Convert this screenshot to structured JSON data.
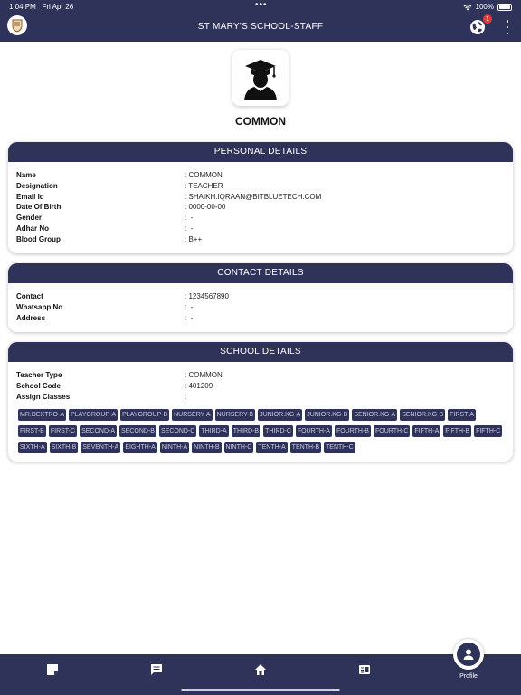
{
  "status": {
    "time": "1:04 PM",
    "date": "Fri Apr 26",
    "battery": "100%"
  },
  "header": {
    "title": "ST MARY'S SCHOOL-STAFF",
    "notification_count": "1"
  },
  "profile": {
    "name": "COMMON"
  },
  "personal": {
    "title": "PERSONAL DETAILS",
    "rows": [
      {
        "label": "Name",
        "value": ": COMMON"
      },
      {
        "label": "Designation",
        "value": ": TEACHER"
      },
      {
        "label": "Email Id",
        "value": ": SHAIKH.IQRAAN@BITBLUETECH.COM"
      },
      {
        "label": "Date Of Birth",
        "value": ": 0000-00-00"
      },
      {
        "label": "Gender",
        "value": ":  -"
      },
      {
        "label": "Adhar No",
        "value": ":  -"
      },
      {
        "label": "Blood Group",
        "value": ": B++"
      }
    ]
  },
  "contact": {
    "title": "CONTACT DETAILS",
    "rows": [
      {
        "label": "Contact",
        "value": ": 1234567890"
      },
      {
        "label": "Whatsapp No",
        "value": ":  -"
      },
      {
        "label": "Address",
        "value": ":  -"
      }
    ]
  },
  "school": {
    "title": "SCHOOL DETAILS",
    "rows": [
      {
        "label": "Teacher Type",
        "value": ": COMMON"
      },
      {
        "label": "School Code",
        "value": ": 401209"
      },
      {
        "label": "Assign Classes",
        "value": ":"
      }
    ],
    "classes": [
      "MR.DEXTRO-A",
      "PLAYGROUP-A",
      "PLAYGROUP-B",
      "NURSERY-A",
      "NURSERY-B",
      "JUNIOR.KG-A",
      "JUNIOR.KG-B",
      "SENIOR.KG-A",
      "SENIOR.KG-B",
      "FIRST-A",
      "FIRST-B",
      "FIRST-C",
      "SECOND-A",
      "SECOND-B",
      "SECOND-C",
      "THIRD-A",
      "THIRD-B",
      "THIRD-C",
      "FOURTH-A",
      "FOURTH-B",
      "FOURTH-C",
      "FIFTH-A",
      "FIFTH-B",
      "FIFTH-C",
      "SIXTH-A",
      "SIXTH-B",
      "SEVENTH-A",
      "EIGHTH-A",
      "NINTH-A",
      "NINTH-B",
      "NINTH-C",
      "TENTH-A",
      "TENTH-B",
      "TENTH-C"
    ]
  },
  "bottom_nav": {
    "profile_label": "Profile"
  },
  "icons": {
    "logo": "school-crest-icon",
    "globe": "globe-icon",
    "menu": "more-vert-icon",
    "avatar": "graduate-icon"
  },
  "colors": {
    "primary": "#303359",
    "badge": "#e53935"
  }
}
